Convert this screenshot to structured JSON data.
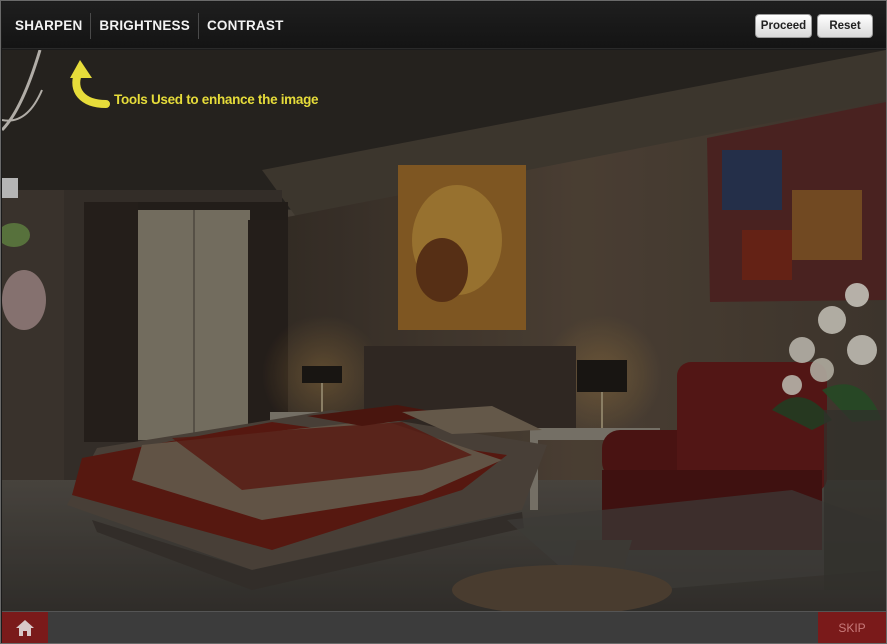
{
  "toolbar": {
    "tools": [
      "SHARPEN",
      "BRIGHTNESS",
      "CONTRAST"
    ],
    "proceed_label": "Proceed",
    "reset_label": "Reset"
  },
  "annotation": {
    "text": "Tools Used to enhance the image",
    "color": "#e6dc3a"
  },
  "bottombar": {
    "home_icon": "home-icon",
    "skip_label": "SKIP",
    "accent": "#7a1a1a"
  }
}
